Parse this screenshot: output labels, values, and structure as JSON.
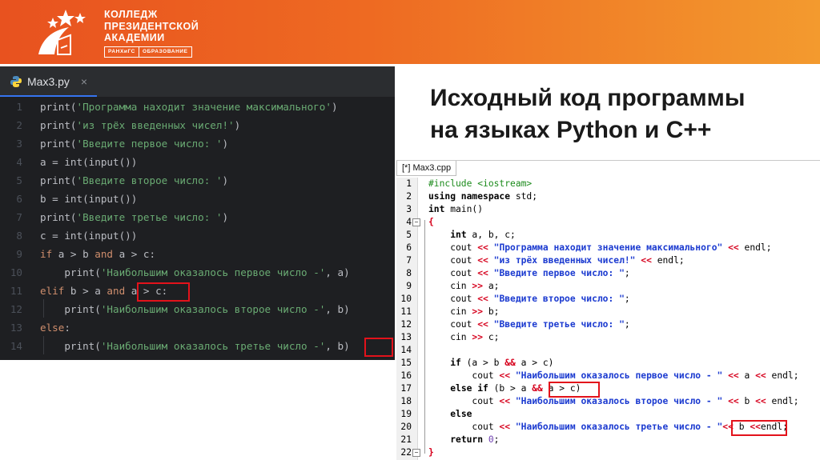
{
  "header": {
    "logo_lines": [
      "КОЛЛЕДЖ",
      "ПРЕЗИДЕНТСКОЙ",
      "АКАДЕМИИ"
    ],
    "badges": [
      "РАНХиГС",
      "ОБРАЗОВАНИЕ"
    ],
    "colors": {
      "band_start": "#e8521f",
      "band_end": "#f39a2e"
    }
  },
  "title": {
    "line1": "Исходный код программы",
    "line2": "на языках Python и C++"
  },
  "python_editor": {
    "tab_name": "Max3.py",
    "tab_close": "×",
    "lines": [
      "print('Программа находит значение максимального')",
      "print('из трёх введенных чисел!')",
      "print('Введите первое число: ')",
      "a = int(input())",
      "print('Введите второе число: ')",
      "b = int(input())",
      "print('Введите третье число: ')",
      "c = int(input())",
      "if a > b and a > c:",
      "    print('Наибольшим оказалось первое число -', a)",
      "elif b > a and a > c:",
      "    print('Наибольшим оказалось второе число -', b)",
      "else:",
      "    print('Наибольшим оказалось третье число -', b)"
    ],
    "line_numbers": [
      "1",
      "2",
      "3",
      "4",
      "5",
      "6",
      "7",
      "8",
      "9",
      "10",
      "11",
      "12",
      "13",
      "14"
    ]
  },
  "cpp_editor": {
    "tab_name": "[*] Max3.cpp",
    "line_numbers": [
      "1",
      "2",
      "3",
      "4",
      "5",
      "6",
      "7",
      "8",
      "9",
      "10",
      "11",
      "12",
      "13",
      "14",
      "15",
      "16",
      "17",
      "18",
      "19",
      "20",
      "21",
      "22"
    ],
    "lines": [
      "#include <iostream>",
      "using namespace std;",
      "int main()",
      "{",
      "    int a, b, c;",
      "    cout << \"Программа находит значение максимального\" << endl;",
      "    cout << \"из трёх введенных чисел!\" << endl;",
      "    cout << \"Введите первое число: \";",
      "    cin >> a;",
      "    cout << \"Введите второе число: \";",
      "    cin >> b;",
      "    cout << \"Введите третье число: \";",
      "    cin >> c;",
      "",
      "    if (a > b && a > c)",
      "        cout << \"Наибольшим оказалось первое число - \" << a << endl;",
      "    else if (b > a && a > c)",
      "        cout << \"Наибольшим оказалось второе число - \" << b << endl;",
      "    else",
      "        cout << \"Наибольшим оказалось третье число - \" << b << endl;",
      "    return 0;",
      "}"
    ],
    "fold_markers": [
      "−",
      "−"
    ]
  }
}
